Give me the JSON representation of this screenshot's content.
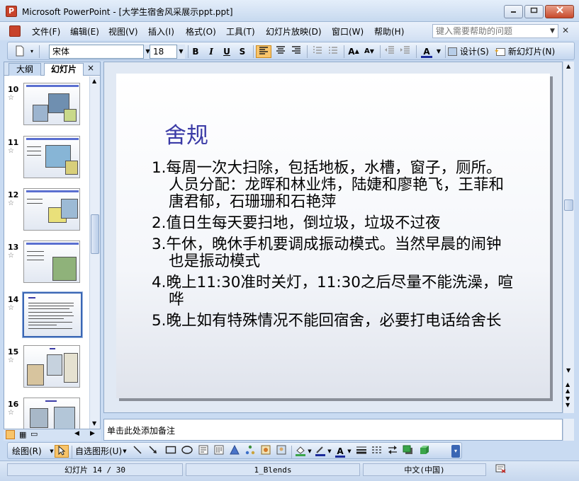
{
  "window": {
    "title": "Microsoft PowerPoint - [大学生宿舍风采展示ppt.ppt]",
    "app_icon": "P"
  },
  "menu": {
    "items": [
      "文件(F)",
      "编辑(E)",
      "视图(V)",
      "插入(I)",
      "格式(O)",
      "工具(T)",
      "幻灯片放映(D)",
      "窗口(W)",
      "帮助(H)"
    ],
    "help_placeholder": "键入需要帮助的问题"
  },
  "toolbar": {
    "font": "宋体",
    "size": "18",
    "bold": "B",
    "italic": "I",
    "underline": "U",
    "shadow": "S",
    "font_color": "A",
    "design": "设计(S)",
    "new_slide": "新幻灯片(N)"
  },
  "leftpane": {
    "tab_outline": "大纲",
    "tab_slides": "幻灯片",
    "close": "×",
    "thumbnails": [
      {
        "num": "10",
        "star": "☆"
      },
      {
        "num": "11",
        "star": "☆"
      },
      {
        "num": "12",
        "star": "☆"
      },
      {
        "num": "13",
        "star": "☆"
      },
      {
        "num": "14",
        "star": "☆",
        "selected": true
      },
      {
        "num": "15",
        "star": "☆"
      },
      {
        "num": "16",
        "star": "☆"
      }
    ]
  },
  "slide": {
    "title": "舍规",
    "points": [
      "1.每周一次大扫除，包括地板，水槽，窗子，厕所。人员分配：龙晖和林业炜，陆婕和廖艳飞，王菲和唐君郁，石珊珊和石艳萍",
      "2.值日生每天要扫地，倒垃圾，垃圾不过夜",
      "3.午休，晚休手机要调成振动模式。当然早晨的闹钟也是振动模式",
      "4.晚上11:30准时关灯，11:30之后尽量不能洗澡，喧哗",
      "5.晚上如有特殊情况不能回宿舍，必要打电话给舍长"
    ]
  },
  "notes": {
    "placeholder": "单击此处添加备注"
  },
  "drawbar": {
    "draw": "绘图(R)",
    "autoshapes": "自选图形(U)"
  },
  "status": {
    "slide": "幻灯片 14 / 30",
    "design": "1_Blends",
    "language": "中文(中国)"
  }
}
